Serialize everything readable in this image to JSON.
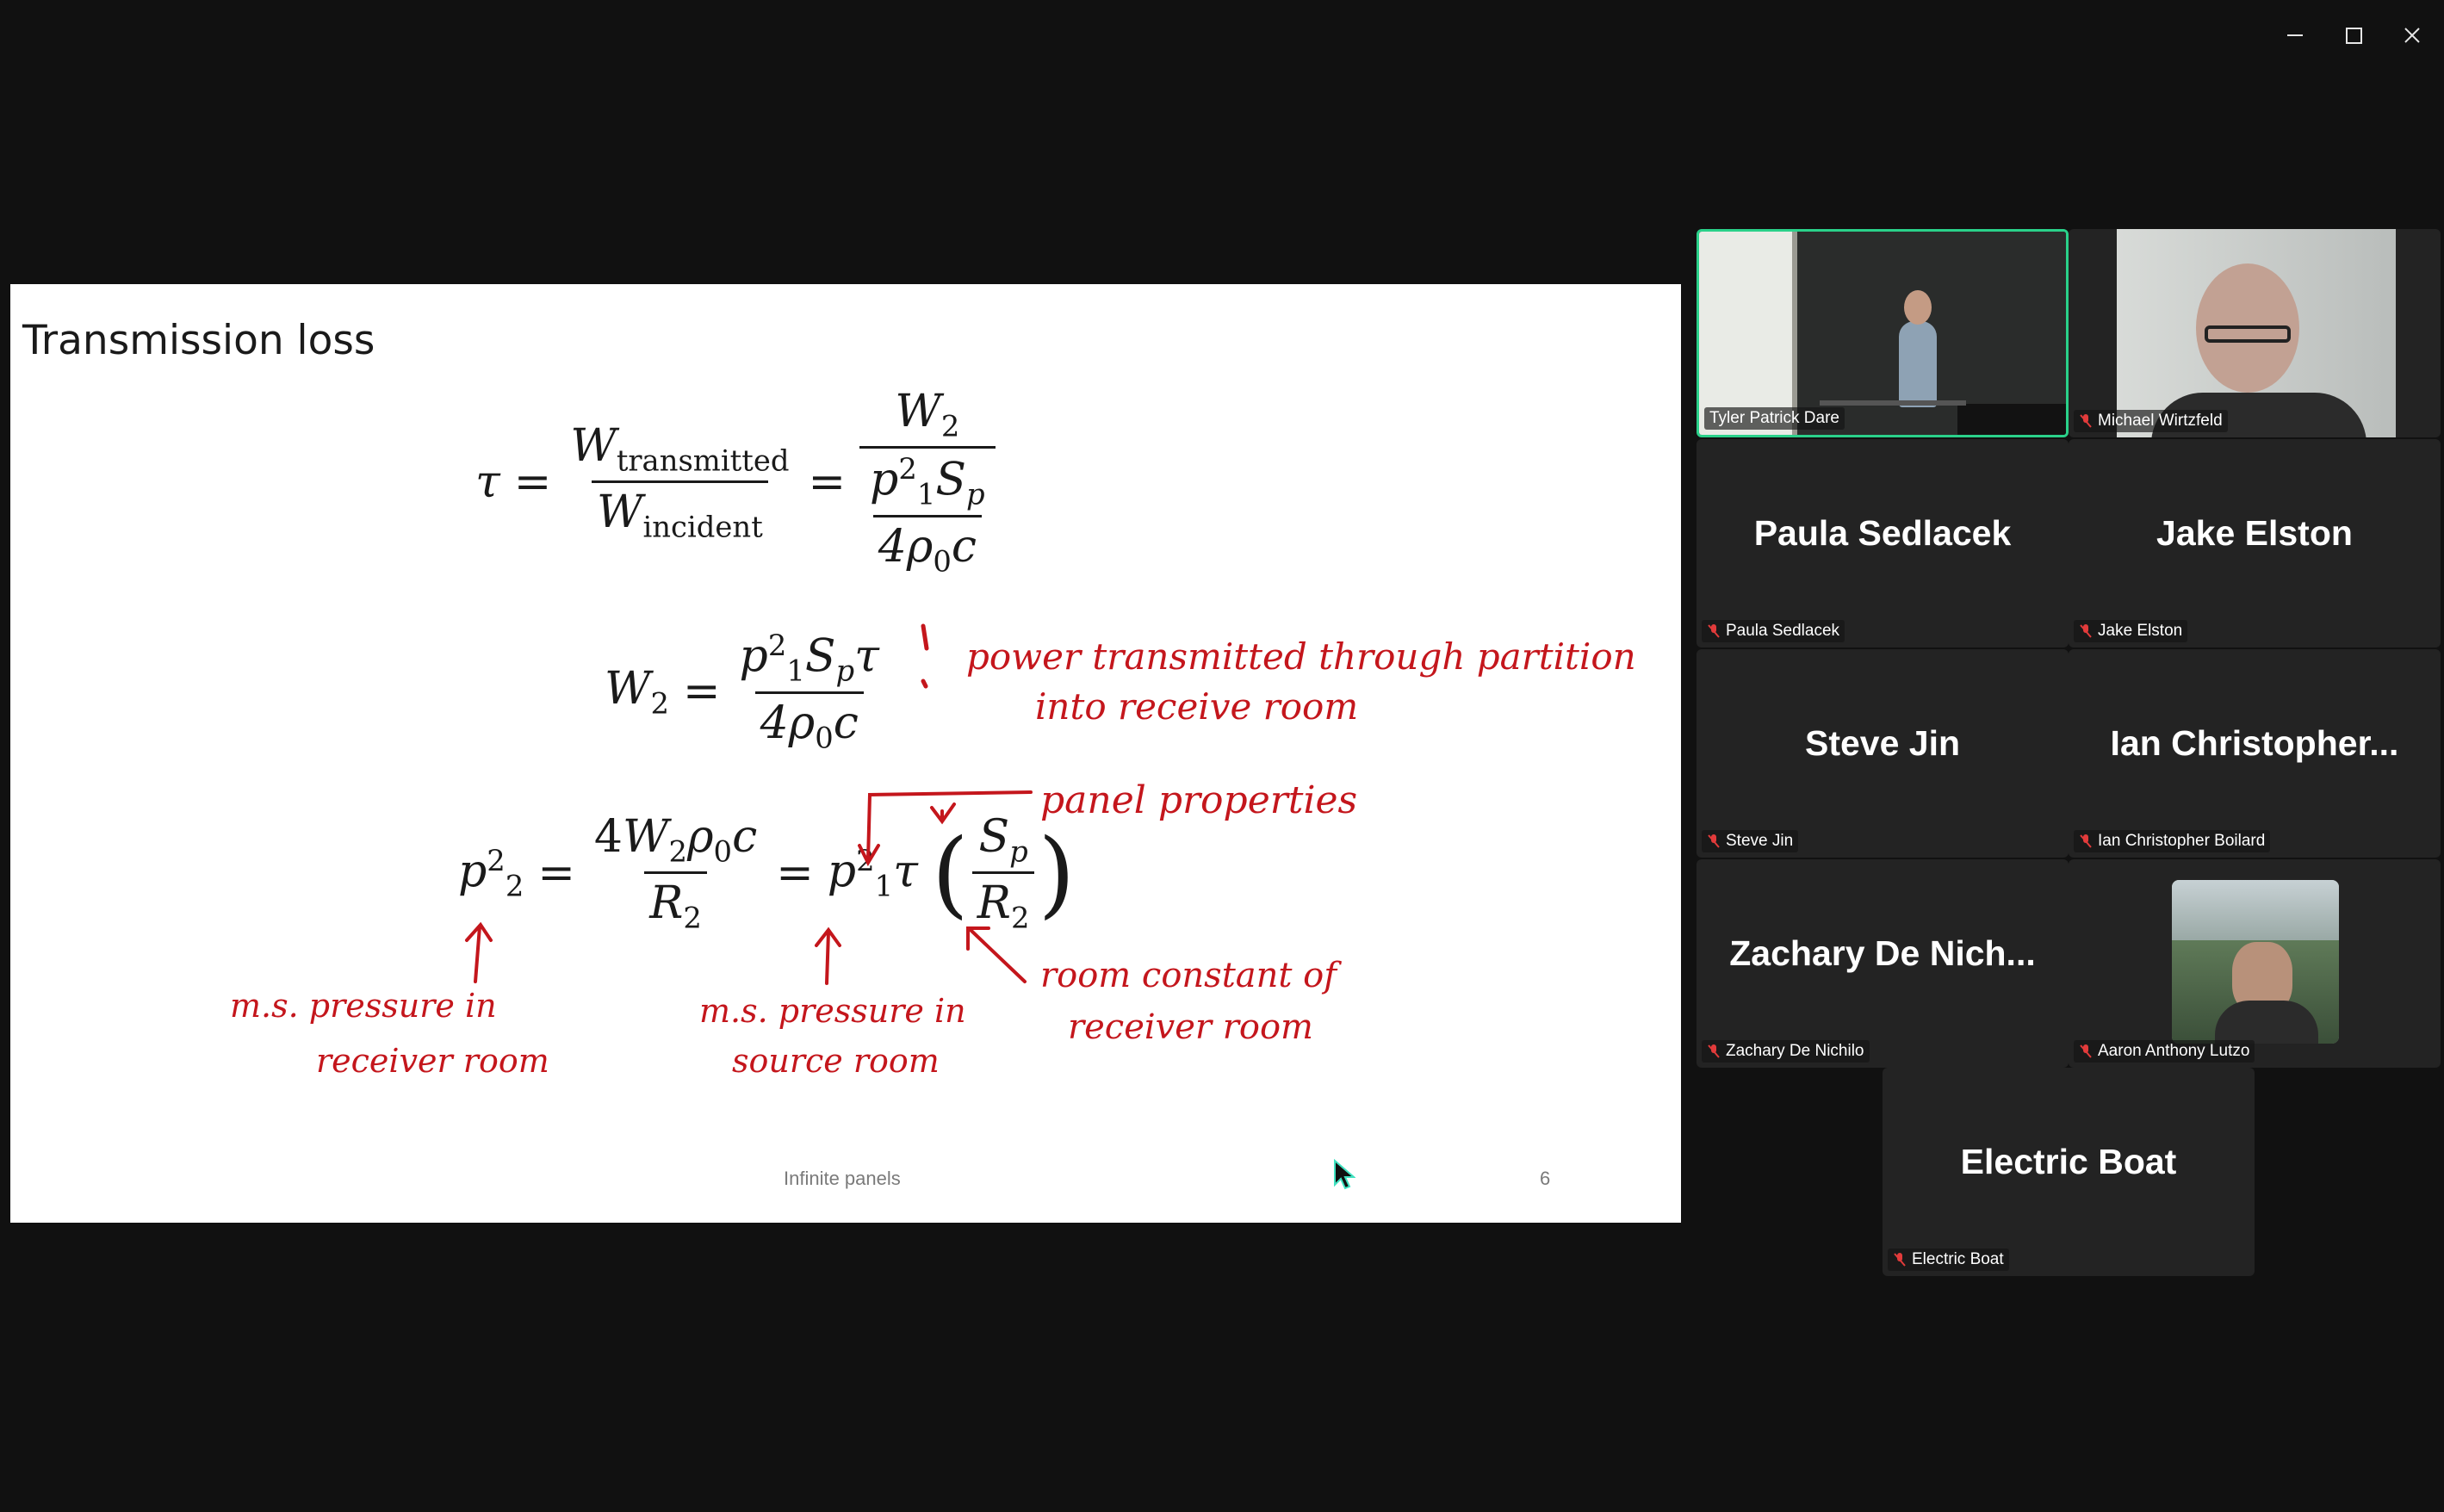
{
  "window": {
    "controls": [
      "minimize",
      "maximize",
      "close"
    ]
  },
  "slide": {
    "title": "Transmission loss",
    "footer": "Infinite panels",
    "page_number": "6",
    "eq1": {
      "tau": "τ",
      "eq": "=",
      "W_tr": "W",
      "sub_transmitted": "transmitted",
      "W_in": "W",
      "sub_incident": "incident",
      "W2": "W",
      "two": "2",
      "p1": "p",
      "one": "1",
      "S": "S",
      "sub_p": "p",
      "four_rho": "4ρ",
      "zero": "0",
      "c": "c"
    },
    "annotations": {
      "power": "power transmitted through partition",
      "power2": "into receive room",
      "panel": "panel properties",
      "ms_receiver_1": "m.s. pressure in",
      "ms_receiver_2": "receiver room",
      "ms_source_1": "m.s. pressure in",
      "ms_source_2": "source room",
      "room_const_1": "room constant of",
      "room_const_2": "receiver room"
    }
  },
  "participants": [
    {
      "name": "Tyler Patrick Dare",
      "display": "",
      "video": true,
      "active_speaker": true,
      "muted": false
    },
    {
      "name": "Michael Wirtzfeld",
      "display": "",
      "video": true,
      "active_speaker": false,
      "muted": true
    },
    {
      "name": "Paula Sedlacek",
      "display": "Paula Sedlacek",
      "video": false,
      "muted": true
    },
    {
      "name": "Jake Elston",
      "display": "Jake Elston",
      "video": false,
      "muted": true
    },
    {
      "name": "Steve Jin",
      "display": "Steve Jin",
      "video": false,
      "muted": true
    },
    {
      "name": "Ian Christopher Boilard",
      "display": "Ian  Christopher...",
      "video": false,
      "muted": true
    },
    {
      "name": "Zachary De Nichilo",
      "display": "Zachary  De  Nich...",
      "video": false,
      "muted": true
    },
    {
      "name": "Aaron Anthony Lutzo",
      "display": "",
      "video": true,
      "muted": true
    },
    {
      "name": "Electric Boat",
      "display": "Electric Boat",
      "video": false,
      "muted": true
    }
  ],
  "colors": {
    "background": "#111111",
    "tile": "#232323",
    "active_border": "#2ad18a",
    "ink": "#c4161c",
    "muted_icon": "#e23b3b"
  }
}
